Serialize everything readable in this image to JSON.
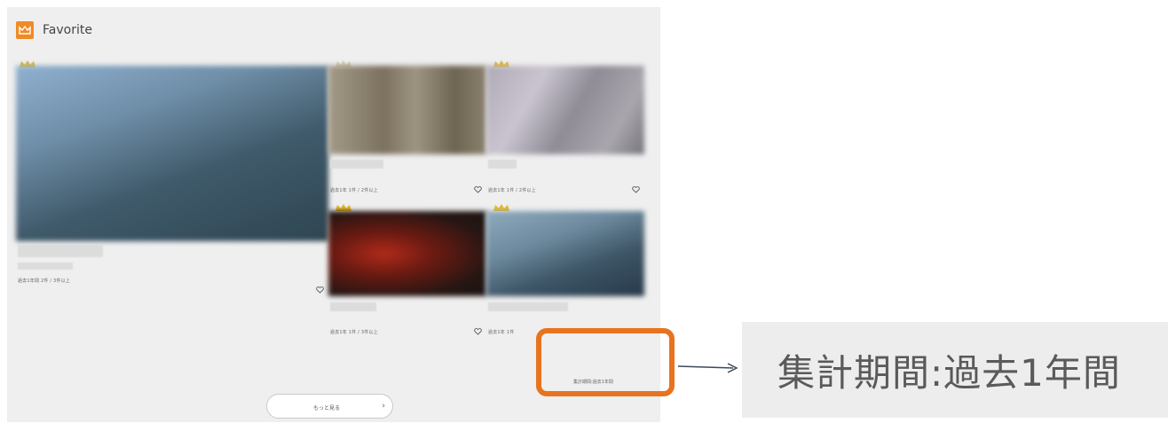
{
  "header": {
    "title": "Favorite"
  },
  "cards": [
    {
      "meta": "過去1年間 2件 / 3件以上"
    },
    {
      "meta": "過去1年 1件 / 2件以上"
    },
    {
      "meta": "過去1年 1件 / 2件以上"
    },
    {
      "meta": "過去1年 1件 / 3件以上"
    },
    {
      "meta": "過去1年 1件"
    }
  ],
  "period_small": "集計期間:過去1年間",
  "period_zoom": "集計期間:過去1年間",
  "more_button": {
    "label": "もっと見る"
  },
  "colors": {
    "accent": "#e8731f",
    "crown": "#e8b824",
    "logo": "#f08a24"
  }
}
